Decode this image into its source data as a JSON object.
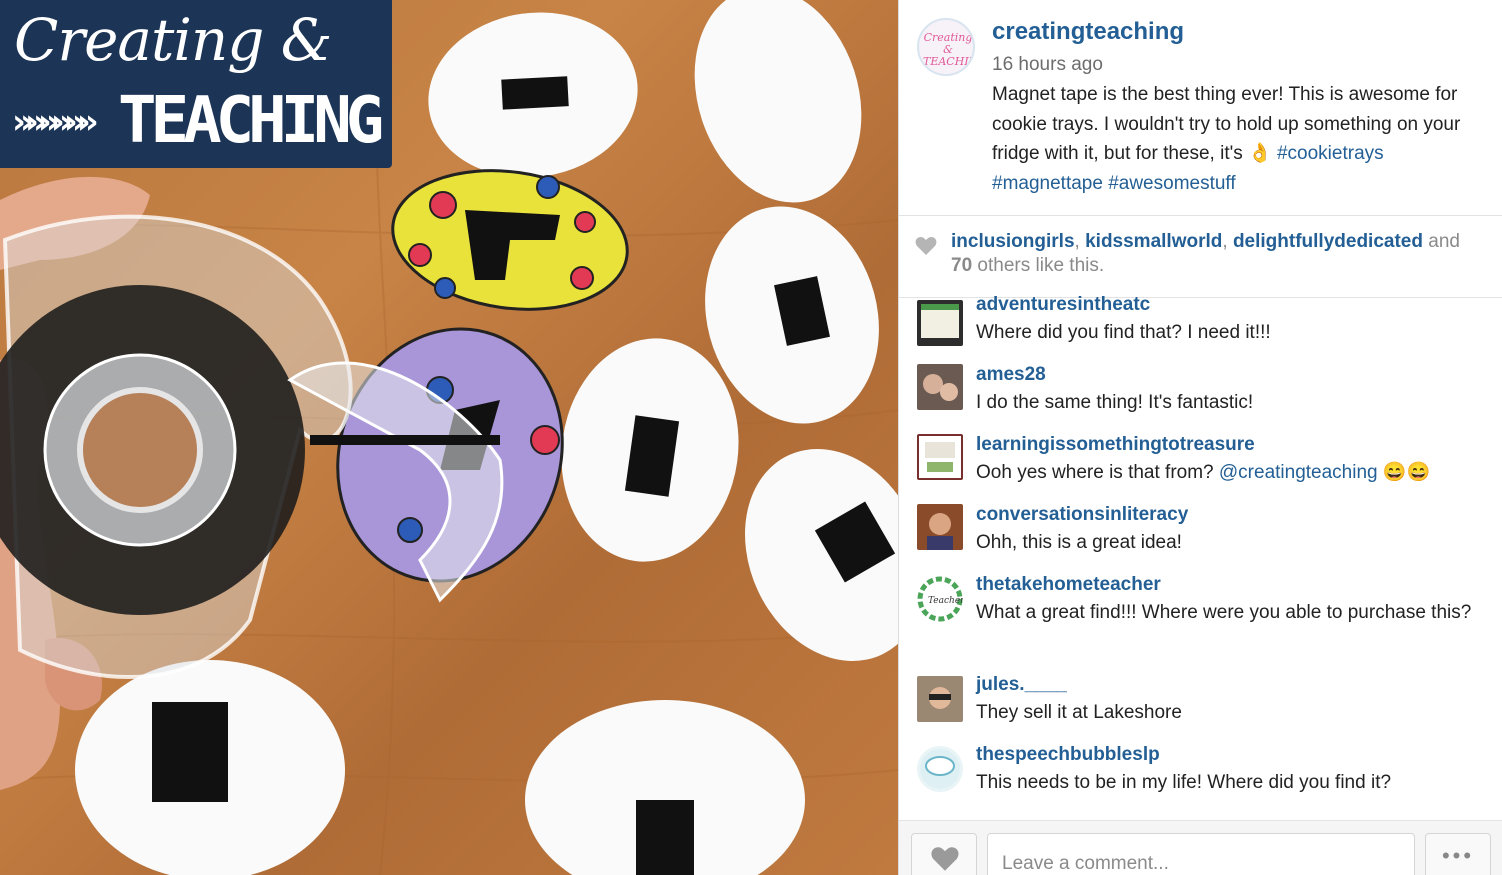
{
  "photo": {
    "logo_script": "Creating &",
    "logo_arrows": "»»»»»»",
    "logo_main": "TEACHING"
  },
  "post": {
    "username": "creatingteaching",
    "timestamp": "16 hours ago",
    "caption_text": "Magnet tape is the best thing ever! This is awesome for cookie trays. I wouldn't try to hold up something on your fridge with it, but for these, it's",
    "caption_emoji": "👌",
    "hashtags": [
      "#cookietrays",
      "#magnettape",
      "#awesomestuff"
    ]
  },
  "likes": {
    "users": [
      "inclusiongirls",
      "kidssmallworld",
      "delightfullydedicated"
    ],
    "and": "and",
    "count": "70",
    "suffix": "others like this."
  },
  "comments": [
    {
      "user": "adventuresintheatc",
      "text": "Where did you find that? I need it!!!"
    },
    {
      "user": "ames28",
      "text": "I do the same thing! It's fantastic!"
    },
    {
      "user": "learningissomethingtotreasure",
      "text": "Ooh yes where is that from?",
      "mention": "@creatingteaching",
      "emoji": "😄😄"
    },
    {
      "user": "conversationsinliteracy",
      "text": "Ohh, this is a great idea!"
    },
    {
      "user": "thetakehometeacher",
      "text": "What a great find!!! Where were you able to purchase this?"
    },
    {
      "user": "jules.____",
      "text": "They sell it at Lakeshore"
    },
    {
      "user": "thespeechbubbleslp",
      "text": "This needs to be in my life! Where did you find it?"
    }
  ],
  "footer": {
    "comment_placeholder": "Leave a comment...",
    "more_label": "•••"
  },
  "colors": {
    "link": "#235f95",
    "logo_bg": "#1c3557",
    "table_wood": "#c07a40"
  },
  "icons": {
    "like": "heart-icon",
    "more": "ellipsis-icon"
  }
}
